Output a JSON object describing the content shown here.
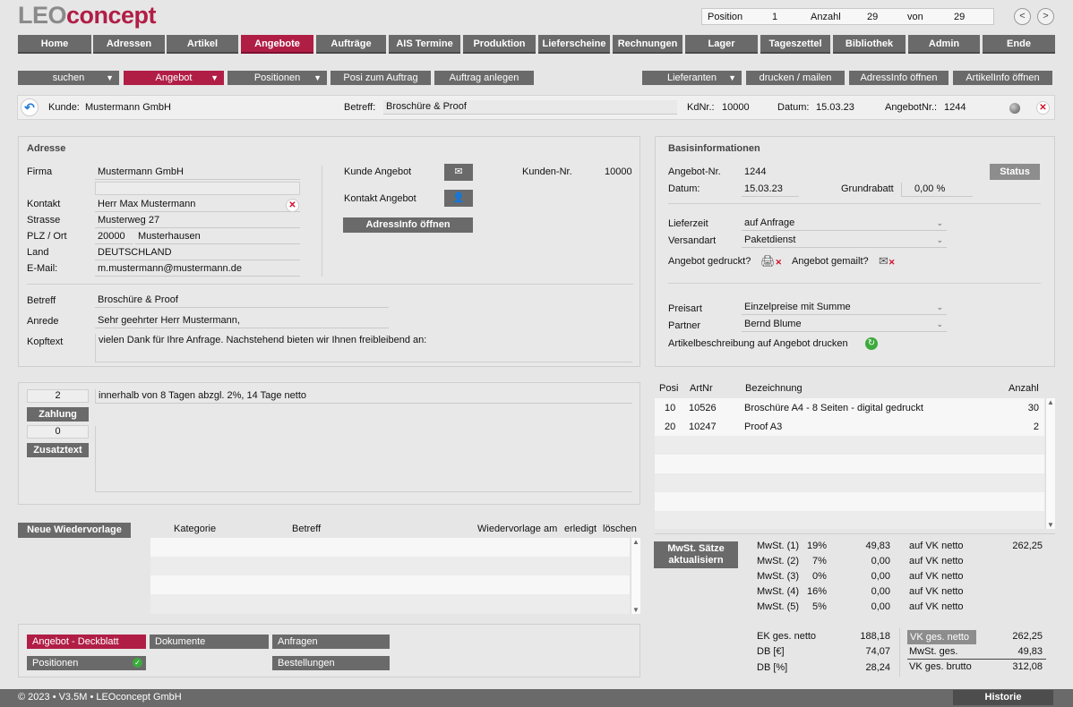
{
  "brand": {
    "part1": "LEO",
    "part2": "concept"
  },
  "position_box": {
    "position_label": "Position",
    "position_value": "1",
    "anzahl_label": "Anzahl",
    "anzahl_value": "29",
    "von_label": "von",
    "von_value": "29"
  },
  "nav": [
    {
      "label": "Home"
    },
    {
      "label": "Adressen"
    },
    {
      "label": "Artikel"
    },
    {
      "label": "Angebote"
    },
    {
      "label": "Aufträge"
    },
    {
      "label": "AIS Termine"
    },
    {
      "label": "Produktion"
    },
    {
      "label": "Lieferscheine"
    },
    {
      "label": "Rechnungen"
    },
    {
      "label": "Lager"
    },
    {
      "label": "Tageszettel"
    },
    {
      "label": "Bibliothek"
    },
    {
      "label": "Admin"
    },
    {
      "label": "Ende"
    }
  ],
  "toolbar": {
    "suchen": "suchen",
    "angebot": "Angebot",
    "positionen": "Positionen",
    "posi_zum_auftrag": "Posi zum Auftrag",
    "auftrag_anlegen": "Auftrag anlegen",
    "lieferanten": "Lieferanten",
    "drucken_mailen": "drucken / mailen",
    "adressinfo": "AdressInfo öffnen",
    "artikelinfo": "ArtikelInfo öffnen"
  },
  "kundebar": {
    "kunde_label": "Kunde:",
    "kunde_value": "Mustermann GmbH",
    "betreff_label": "Betreff:",
    "betreff_value": "Broschüre & Proof",
    "kdnr_label": "KdNr.:",
    "kdnr_value": "10000",
    "datum_label": "Datum:",
    "datum_value": "15.03.23",
    "angebotnr_label": "AngebotNr.:",
    "angebotnr_value": "1244"
  },
  "adresse": {
    "title": "Adresse",
    "firma_label": "Firma",
    "firma": "Mustermann GmbH",
    "firma2": "",
    "kontakt_label": "Kontakt",
    "kontakt": "Herr Max Mustermann",
    "strasse_label": "Strasse",
    "strasse": "Musterweg 27",
    "plz_label": "PLZ / Ort",
    "plz": "20000",
    "ort": "Musterhausen",
    "land_label": "Land",
    "land": "DEUTSCHLAND",
    "email_label": "E-Mail:",
    "email": "m.mustermann@mustermann.de",
    "kunde_angebot_label": "Kunde Angebot",
    "kontakt_angebot_label": "Kontakt Angebot",
    "adressinfo_button": "AdressInfo öffnen",
    "kundennr_label": "Kunden-Nr.",
    "kundennr": "10000",
    "betreff_label": "Betreff",
    "betreff": "Broschüre & Proof",
    "anrede_label": "Anrede",
    "anrede": "Sehr geehrter Herr Mustermann,",
    "kopftext_label": "Kopftext",
    "kopftext": "vielen Dank für Ihre Anfrage. Nachstehend bieten wir Ihnen freibleibend an:"
  },
  "basis": {
    "title": "Basisinformationen",
    "angebotnr_label": "Angebot-Nr.",
    "angebotnr": "1244",
    "status_button": "Status",
    "datum_label": "Datum:",
    "datum": "15.03.23",
    "grundrabatt_label": "Grundrabatt",
    "grundrabatt": "0,00 %",
    "lieferzeit_label": "Lieferzeit",
    "lieferzeit": "auf Anfrage",
    "versandart_label": "Versandart",
    "versandart": "Paketdienst",
    "gedruckt_label": "Angebot gedruckt?",
    "gemailt_label": "Angebot gemailt?",
    "preisart_label": "Preisart",
    "preisart": "Einzelpreise mit Summe",
    "partner_label": "Partner",
    "partner": "Bernd Blume",
    "artikelbeschreibung_label": "Artikelbeschreibung auf Angebot drucken"
  },
  "zahlung": {
    "zahlung_number": "2",
    "zahlung_text": "innerhalb von 8 Tagen abzgl. 2%, 14 Tage netto",
    "zahlung_button": "Zahlung",
    "zusatz_number": "0",
    "zusatz_button": "Zusatztext"
  },
  "positions": {
    "headers": {
      "posi": "Posi",
      "artnr": "ArtNr",
      "bezeichnung": "Bezeichnung",
      "anzahl": "Anzahl"
    },
    "rows": [
      {
        "posi": "10",
        "artnr": "10526",
        "bezeichnung": "Broschüre A4 - 8 Seiten - digital gedruckt",
        "anzahl": "30"
      },
      {
        "posi": "20",
        "artnr": "10247",
        "bezeichnung": "Proof A3",
        "anzahl": "2"
      }
    ]
  },
  "wiedervorlage": {
    "button": "Neue Wiedervorlage",
    "headers": {
      "kategorie": "Kategorie",
      "betreff": "Betreff",
      "am": "Wiedervorlage am",
      "erledigt": "erledigt",
      "loeschen": "löschen"
    }
  },
  "mwst": {
    "button_line1": "MwSt. Sätze",
    "button_line2": "aktualisiern",
    "rows": [
      {
        "label": "MwSt. (1)",
        "rate": "19%",
        "value": "49,83",
        "basis": "auf VK netto",
        "amount": "262,25"
      },
      {
        "label": "MwSt. (2)",
        "rate": "7%",
        "value": "0,00",
        "basis": "auf VK netto",
        "amount": ""
      },
      {
        "label": "MwSt. (3)",
        "rate": "0%",
        "value": "0,00",
        "basis": "auf VK netto",
        "amount": ""
      },
      {
        "label": "MwSt. (4)",
        "rate": "16%",
        "value": "0,00",
        "basis": "auf VK netto",
        "amount": ""
      },
      {
        "label": "MwSt. (5)",
        "rate": "5%",
        "value": "0,00",
        "basis": "auf VK netto",
        "amount": ""
      }
    ]
  },
  "tabs": {
    "deckblatt": "Angebot - Deckblatt",
    "dokumente": "Dokumente",
    "anfragen": "Anfragen",
    "positionen": "Positionen",
    "bestellungen": "Bestellungen"
  },
  "totals": {
    "ek_label": "EK ges. netto",
    "ek": "188,18",
    "db_eur_label": "DB [€]",
    "db_eur": "74,07",
    "db_pct_label": "DB [%]",
    "db_pct": "28,24",
    "vk_netto_label": "VK ges. netto",
    "vk_netto": "262,25",
    "mwst_label": "MwSt. ges.",
    "mwst": "49,83",
    "vk_brutto_label": "VK ges. brutto",
    "vk_brutto": "312,08"
  },
  "footer": {
    "text": "© 2023 • V3.5M • LEOconcept GmbH",
    "historie": "Historie"
  },
  "colors": {
    "accent": "#b01e46",
    "button": "#6a6a6a",
    "background": "#e6e6e6"
  }
}
